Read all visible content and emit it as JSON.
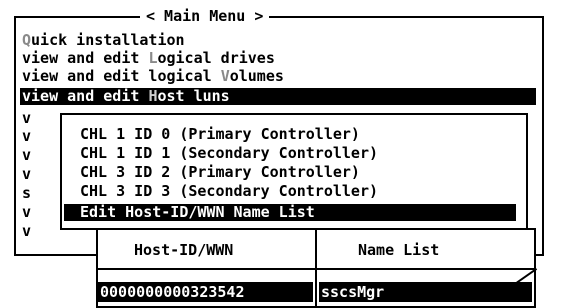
{
  "main_menu": {
    "title": "< Main Menu >",
    "items": [
      {
        "pre": "",
        "hot": "Q",
        "post": "uick installation"
      },
      {
        "pre": "view and edit ",
        "hot": "L",
        "post": "ogical drives"
      },
      {
        "pre": "view and edit logical ",
        "hot": "V",
        "post": "olumes"
      },
      {
        "pre": "view and edit ",
        "hot": "H",
        "post": "ost luns"
      }
    ],
    "partial_items": [
      "v",
      "v",
      "v",
      "v",
      "s",
      "v",
      "v"
    ]
  },
  "submenu": {
    "items": [
      "CHL 1 ID 0 (Primary Controller)",
      "CHL 1 ID 1 (Secondary Controller)",
      "CHL 3 ID 2 (Primary Controller)",
      "CHL 3 ID 3 (Secondary Controller)",
      "Edit Host-ID/WWN Name List"
    ]
  },
  "host_table": {
    "headers": {
      "host_id": "Host-ID/WWN",
      "name": "Name List"
    },
    "row": {
      "host_id": "0000000000323542",
      "name": "sscsMgr"
    }
  }
}
